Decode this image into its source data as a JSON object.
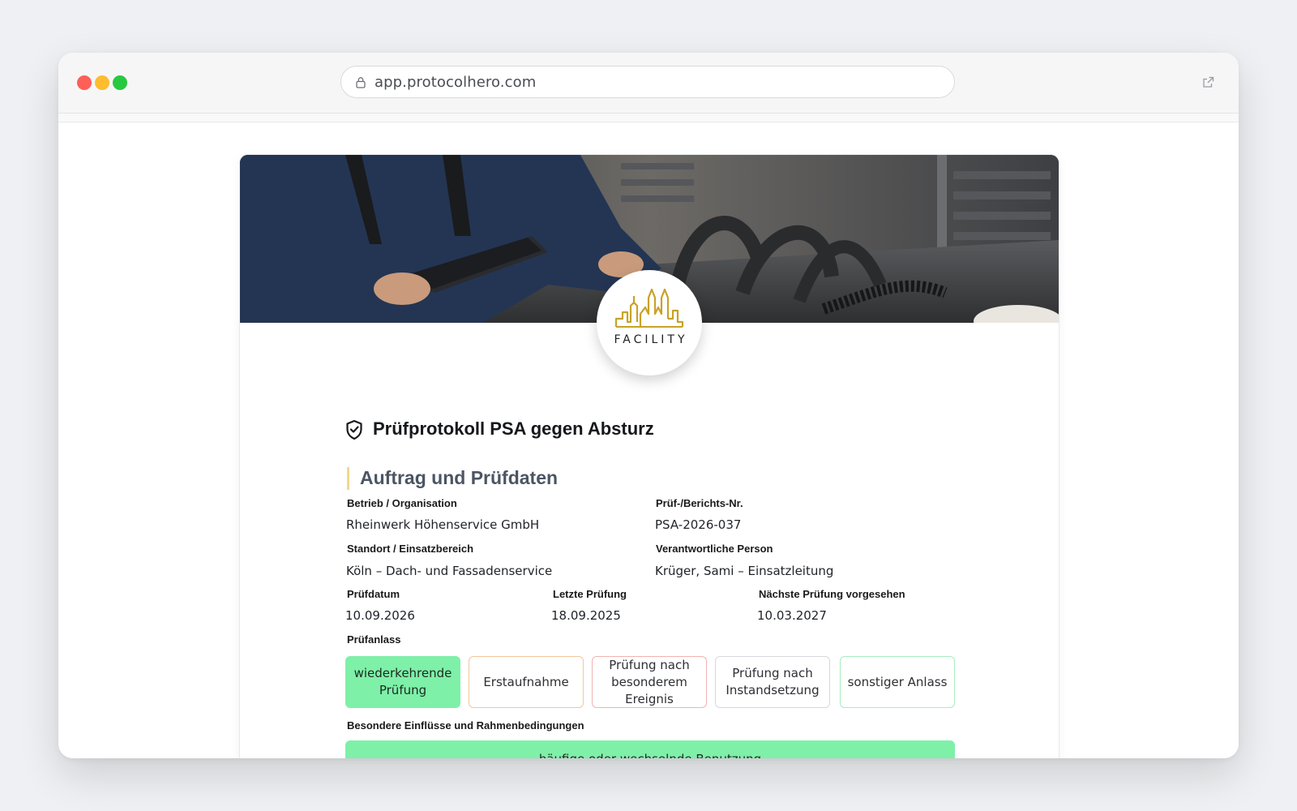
{
  "browser": {
    "url": "app.protocolhero.com"
  },
  "logo": {
    "text": "FACILITY",
    "accent_color": "#c9a227"
  },
  "document": {
    "title": "Prüfprotokoll PSA gegen Absturz"
  },
  "section": {
    "title": "Auftrag und Prüfdaten",
    "accent_color": "#efd98d"
  },
  "fields": {
    "organisation": {
      "label": "Betrieb / Organisation",
      "value": "Rheinwerk Höhenservice GmbH"
    },
    "report_no": {
      "label": "Prüf-/Berichts-Nr.",
      "value": "PSA-2026-037"
    },
    "location": {
      "label": "Standort / Einsatzbereich",
      "value": "Köln – Dach- und Fassadenservice"
    },
    "responsible": {
      "label": "Verantwortliche Person",
      "value": "Krüger, Sami – Einsatzleitung"
    },
    "inspection_date": {
      "label": "Prüfdatum",
      "value": "10.09.2026"
    },
    "last_inspection": {
      "label": "Letzte Prüfung",
      "value": "18.09.2025"
    },
    "next_inspection": {
      "label": "Nächste Prüfung vorgesehen",
      "value": "10.03.2027"
    }
  },
  "inspection_reason": {
    "label": "Prüfanlass",
    "selected": "wiederkehrende Prüfung",
    "options": [
      "wiederkehrende Prüfung",
      "Erstaufnahme",
      "Prüfung nach besonderem Ereignis",
      "Prüfung nach Instandsetzung",
      "sonstiger Anlass"
    ],
    "selected_color": "#7ef0a8"
  },
  "influences": {
    "label": "Besondere Einflüsse und Rahmenbedingungen",
    "selected": "häufige oder wechselnde Benutzung"
  }
}
